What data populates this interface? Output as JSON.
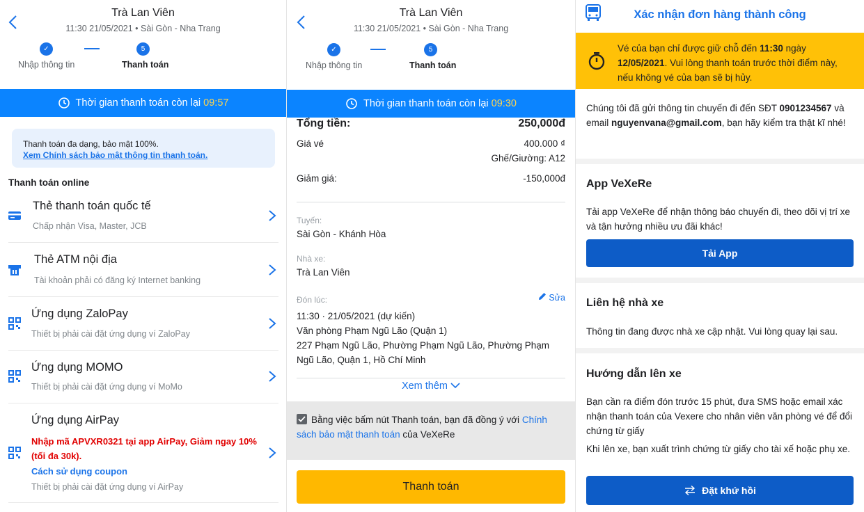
{
  "header": {
    "title": "Trà Lan Viên",
    "subtitle": "11:30 21/05/2021 • Sài Gòn - Nha Trang",
    "step1_label": "Nhập thông tin",
    "step2_label": "Thanh toán",
    "step2_number": "5"
  },
  "screen1": {
    "timer_label": "Thời gian thanh toán còn lại",
    "timer_value": "09:57",
    "notice_text": "Thanh toán đa dạng, bảo mật 100%.",
    "notice_link": "Xem Chính sách bảo mật thông tin thanh toán.",
    "section_title": "Thanh toán online",
    "methods": [
      {
        "name": "Thẻ thanh toán quốc tế",
        "desc": "Chấp nhận Visa, Master, JCB",
        "icon": "credit-card-icon"
      },
      {
        "name": "Thẻ ATM nội địa",
        "desc": "Tài khoản phải có đăng ký Internet banking",
        "icon": "atm-card-icon"
      },
      {
        "name": "Ứng dụng ZaloPay",
        "desc": "Thiết bị phải cài đặt ứng dụng ví ZaloPay",
        "icon": "qr-code-icon"
      },
      {
        "name": "Ứng dụng MOMO",
        "desc": "Thiết bị phải cài đặt ứng dụng ví MoMo",
        "icon": "qr-code-icon"
      },
      {
        "name": "Ứng dụng AirPay",
        "desc": "Thiết bị phải cài đặt ứng dụng ví AirPay",
        "icon": "qr-code-icon",
        "promo": "Nhập mã APVXR0321 tại app AirPay, Giảm ngay 10% (tối đa 30k).",
        "coupon": "Cách sử dụng coupon"
      }
    ]
  },
  "screen2": {
    "timer_label": "Thời gian thanh toán còn lại",
    "timer_value": "09:30",
    "total_label": "Tổng tiền:",
    "total_value": "250,000đ",
    "price_label": "Giá vé",
    "price_value": "400.000 ₫",
    "seat_value": "Ghế/Giường: A12",
    "discount_label": "Giảm giá:",
    "discount_value": "-150,000đ",
    "route_label": "Tuyến:",
    "route_value": "Sài Gòn - Khánh Hòa",
    "operator_label": "Nhà xe:",
    "operator_value": "Trà Lan Viên",
    "pickup_label": "Đón lúc:",
    "edit_label": "Sửa",
    "pickup_time": "11:30 · 21/05/2021 (dự kiến)",
    "pickup_office": "Văn phòng Phạm Ngũ Lão (Quận 1)",
    "pickup_address": "227 Phạm Ngũ Lão, Phường Phạm Ngũ Lão, Phường Phạm Ngũ Lão, Quận 1, Hồ Chí Minh",
    "more_label": "Xem thêm",
    "agree_prefix": "Bằng việc bấm nút Thanh toán, bạn đã đồng ý với",
    "agree_link": "Chính sách bảo mật thanh toán",
    "agree_suffix": "của VeXeRe",
    "pay_button": "Thanh toán"
  },
  "screen3": {
    "title": "Xác nhận đơn hàng thành công",
    "warn_1": "Vé của bạn chỉ được giữ chỗ đến",
    "warn_time": "11:30",
    "warn_2": "ngày",
    "warn_date": "12/05/2021",
    "warn_3": ". Vui lòng thanh toán trước thời điểm này, nếu không vé của bạn sẽ bị hủy.",
    "sent_1": "Chúng tôi đã gửi thông tin chuyến đi đến SĐT",
    "phone": "0901234567",
    "sent_2": "và email",
    "email": "nguyenvana@gmail.com",
    "sent_3": ", bạn hãy kiểm tra thật kĩ nhé!",
    "app_title": "App VeXeRe",
    "app_desc": "Tải app VeXeRe để nhận thông báo chuyến đi, theo dõi vị trí xe và tận hưởng nhiều ưu đãi khác!",
    "app_button": "Tải App",
    "contact_title": "Liên hệ nhà xe",
    "contact_desc": "Thông tin đang được nhà xe cập nhật. Vui lòng quay lại sau.",
    "guide_title": "Hướng dẫn lên xe",
    "guide_1": "Bạn cần ra điểm đón trước 15 phút, đưa SMS hoặc email xác nhận thanh toán của Vexere cho nhân viên văn phòng vé để đổi chứng từ giấy",
    "guide_2": "Khi lên xe, bạn xuất trình chứng từ giấy cho tài xế hoặc phụ xe.",
    "return_button": "Đặt khứ hồi"
  }
}
